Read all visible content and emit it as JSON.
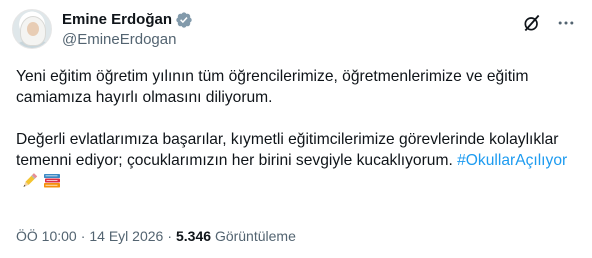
{
  "author": {
    "display_name": "Emine Erdoğan",
    "handle": "@EmineErdogan",
    "verified_color": "#829aab"
  },
  "icons": {
    "grok": "grok-icon",
    "more": "more-options-icon",
    "verified": "verified-badge-icon",
    "pencil": "pencil-emoji",
    "books": "books-emoji"
  },
  "tweet": {
    "para1": "Yeni eğitim öğretim yılının tüm öğrencilerimize, öğretmenlerimize ve eğitim camiamıza hayırlı olmasını diliyorum.",
    "para2_text": "Değerli evlatlarımıza başarılar, kıymetli eğitimcilerimize görevlerinde kolaylıklar temenni ediyor; çocuklarımızın her birini sevgiyle kucaklıyorum. ",
    "hashtag": "#OkullarAçılıyor",
    "hashtag_color": "#1d9bf0"
  },
  "meta": {
    "time": "ÖÖ 10:00",
    "separator": "·",
    "date": "14 Eyl 2026",
    "views_count": "5.346",
    "views_label": "Görüntüleme"
  }
}
